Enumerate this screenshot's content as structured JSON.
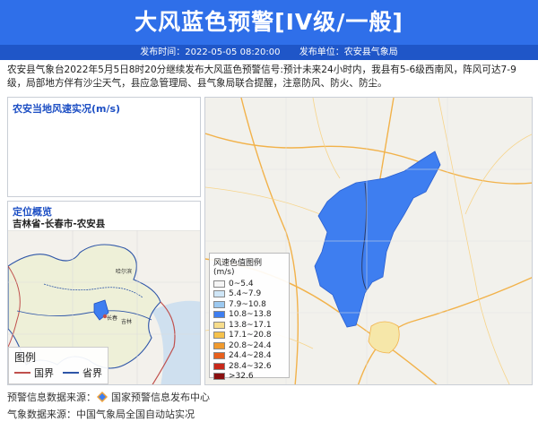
{
  "header": {
    "title": "大风蓝色预警[IV级/一般]"
  },
  "meta": {
    "time": "发布时间：2022-05-05 08:20:00",
    "unit": "发布单位：农安县气象局"
  },
  "description": "农安县气象台2022年5月5日8时20分继续发布大风蓝色预警信号:预计未来24小时内，我县有5-6级西南风，阵风可达7-9级，局部地方伴有沙尘天气，县应急管理局、县气象局联合提醒，注意防风、防火、防尘。",
  "wind_panel": {
    "title": "农安当地风速实况(m/s)"
  },
  "location_panel": {
    "title": "定位概览",
    "path": "吉林省-长春市-农安县"
  },
  "mini_map": {
    "legend_title": "图例",
    "legend_items": [
      "国界",
      "省界"
    ],
    "city_labels": [
      "哈尔滨",
      "长春",
      "吉林"
    ]
  },
  "main_map": {
    "legend_title": "风速色值图例 (m/s)",
    "legend": [
      {
        "label": "0~5.4",
        "color": "#f5f5f5"
      },
      {
        "label": "5.4~7.9",
        "color": "#cfe6f7"
      },
      {
        "label": "7.9~10.8",
        "color": "#9cc9f0"
      },
      {
        "label": "10.8~13.8",
        "color": "#3e7ef0"
      },
      {
        "label": "13.8~17.1",
        "color": "#f7dd8c"
      },
      {
        "label": "17.1~20.8",
        "color": "#f5c24c"
      },
      {
        "label": "20.8~24.4",
        "color": "#f09a2e"
      },
      {
        "label": "24.4~28.4",
        "color": "#e8601c"
      },
      {
        "label": "28.4~32.6",
        "color": "#c8281a"
      },
      {
        "label": ">32.6",
        "color": "#8a0f0f"
      }
    ]
  },
  "footer": {
    "warning_source_label": "预警信息数据来源：",
    "warning_source": "国家预警信息发布中心",
    "weather_source": "气象数据来源：中国气象局全国自动站实况"
  },
  "colors": {
    "header": "#2f6fe9",
    "meta": "#1f56c8",
    "county": "#3e7ef0",
    "border_red": "#c0504d",
    "border_blue": "#2f56a8"
  }
}
